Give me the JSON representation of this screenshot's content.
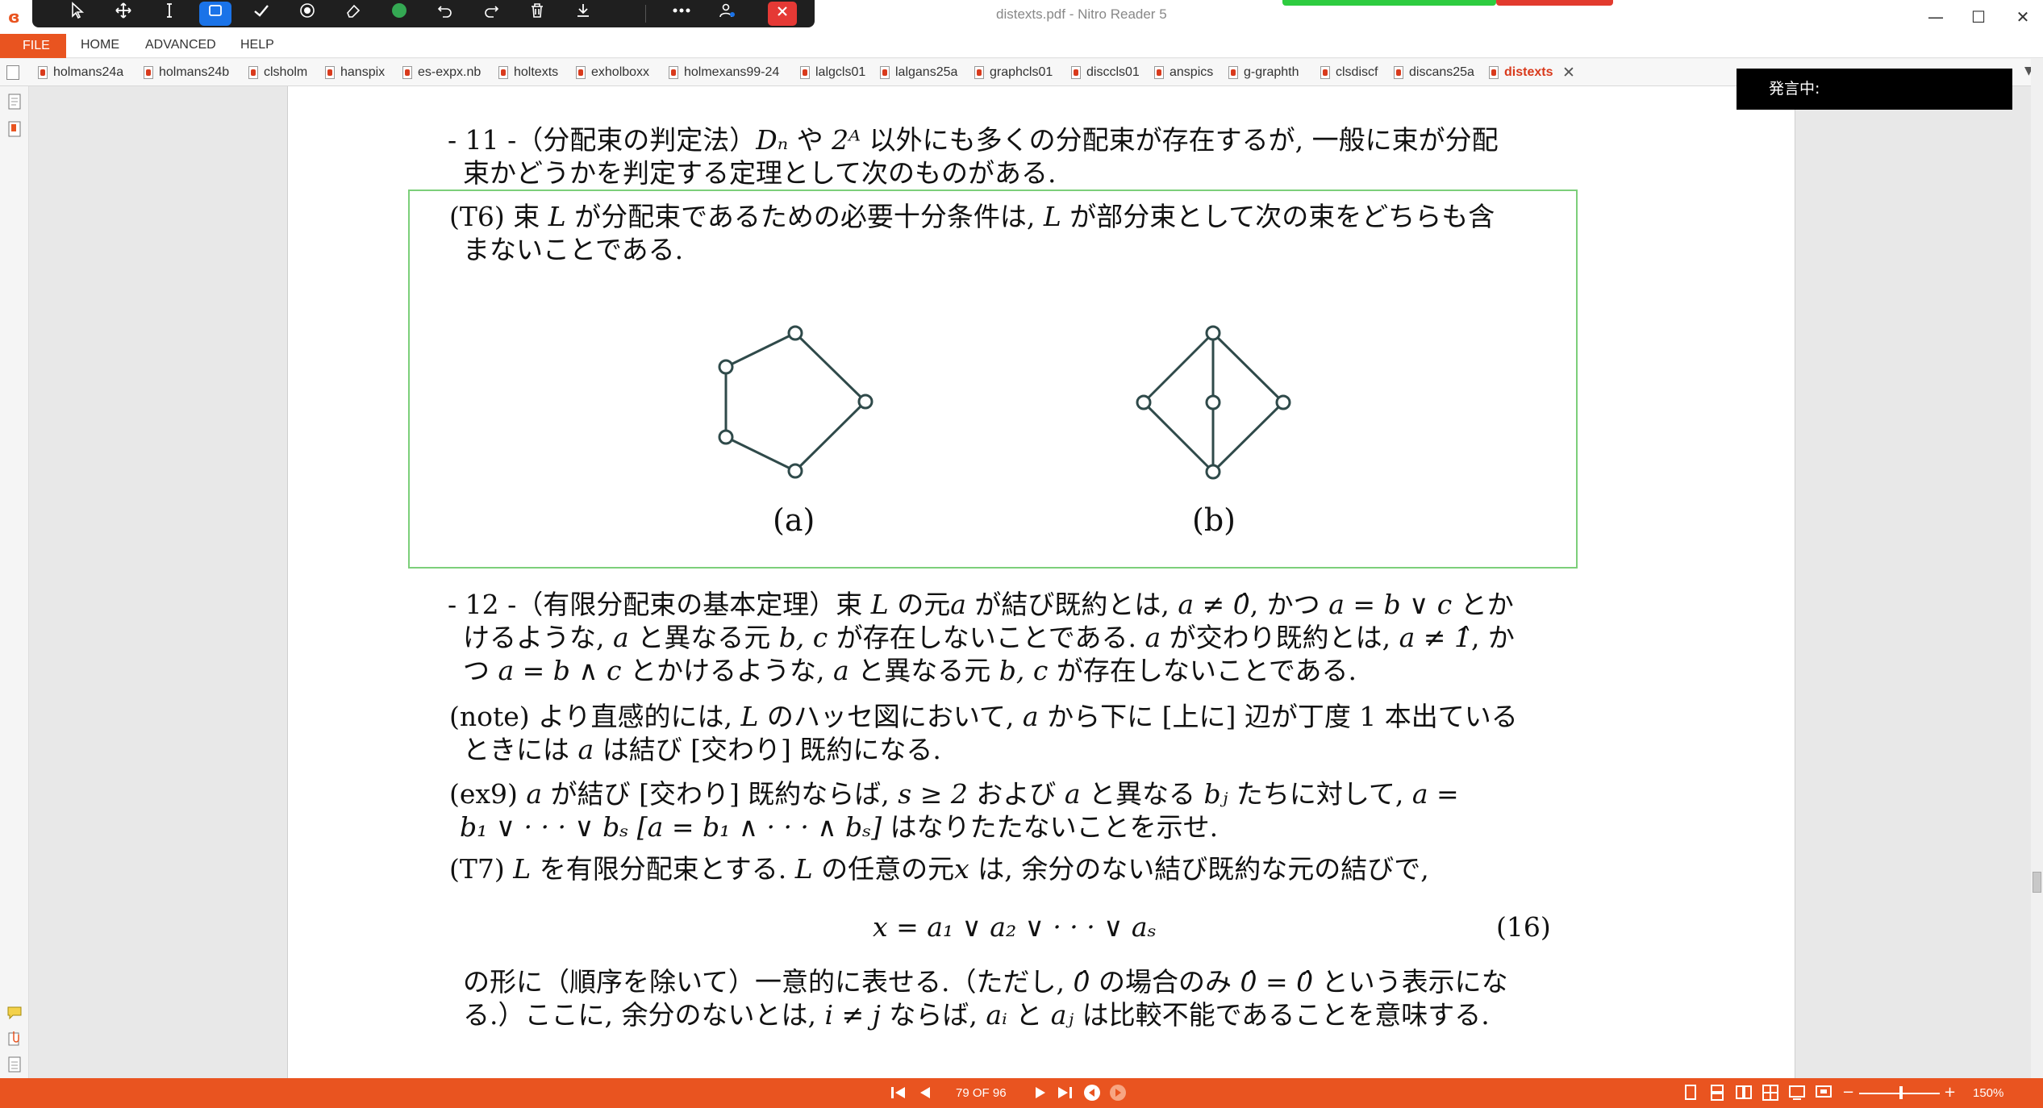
{
  "window": {
    "title": "distexts.pdf - Nitro Reader 5",
    "minimize_glyph": "—",
    "maximize_glyph": "☐",
    "close_glyph": "✕"
  },
  "float_toolbar": {
    "icons": [
      "pointer-icon",
      "move-icon",
      "text-cursor-icon",
      "rectangle-icon",
      "check-icon",
      "target-icon",
      "eraser-icon",
      "color-dot-icon",
      "undo-icon",
      "redo-icon",
      "trash-icon",
      "download-icon",
      "more-icon",
      "people-icon",
      "close-icon"
    ],
    "colors": {
      "active": "#1a73e8",
      "dot": "#34a853",
      "close": "#e53935"
    }
  },
  "menu": {
    "file": "FILE",
    "items": [
      "HOME",
      "ADVANCED",
      "HELP"
    ]
  },
  "tabs": [
    "holmans24a",
    "holmans24b",
    "clsholm",
    "hanspix",
    "es-expx.nb",
    "holtexts",
    "exholboxx",
    "holmexans99-24",
    "lalgcls01",
    "lalgans25a",
    "graphcls01",
    "disccls01",
    "anspics",
    "g-graphth",
    "clsdiscf",
    "discans25a",
    "distexts"
  ],
  "active_tab": "distexts",
  "overlay": {
    "speaking": "発言中:"
  },
  "document": {
    "sec11": {
      "lead": "- 11 -（分配束の判定法）",
      "t1": "や",
      "t2": "以外にも多くの分配束が存在するが, 一般に束が分配",
      "line2": "束かどうかを判定する定理として次のものがある."
    },
    "t6": {
      "lead": "(T6)  束",
      "t1": "が分配束であるための必要十分条件は,",
      "t2": "が部分束として次の束をどちらも含",
      "line2": "まないことである."
    },
    "figure": {
      "label_a": "(a)",
      "label_b": "(b)"
    },
    "sec12": {
      "lead": "- 12 -（有限分配束の基本定理）束",
      "t1": "の元",
      "t2": "が結び既約とは,",
      "t3": ", かつ",
      "t4": "とか",
      "line2a": "けるような,",
      "line2b": "と異なる元",
      "line2c": "が存在しないことである.",
      "line2d": "が交わり既約とは,",
      "line2e": ", か",
      "line3a": "つ",
      "line3b": "とかけるような,",
      "line3c": "と異なる元",
      "line3d": "が存在しないことである."
    },
    "note": {
      "lead": "(note)  より直感的には,",
      "t1": "のハッセ図において,",
      "t2": "から下に [上に] 辺が丁度 1 本出ている",
      "line2a": "ときには",
      "line2b": "は結び [交わり] 既約になる."
    },
    "ex9": {
      "lead": "(ex9)",
      "t1": "が結び [交わり] 既約ならば,",
      "t2": "および",
      "t3": "と異なる",
      "t4": "たちに対して,",
      "line2b": "はなりたたないことを示せ."
    },
    "t7": {
      "lead": "(T7)",
      "t1": "を有限分配束とする.",
      "t2": "の任意の元",
      "t3": "は, 余分のない結び既約な元の結びで,",
      "eq_number": "(16)",
      "line3a": "の形に（順序を除いて）一意的に表せる.（ただし,",
      "line3b": "の場合のみ",
      "line3c": "という表示にな",
      "line4a": "る.）ここに, 余分のないとは,",
      "line4b": "ならば,",
      "line4c": "と",
      "line4d": "は比較不能であることを意味する."
    },
    "math": {
      "Dn": "Dₙ",
      "twoA": "2ᴬ",
      "L": "L",
      "a": "a",
      "a_ne_0": "a ≠ 0̂",
      "a_eq_bvc": "a = b ∨ c",
      "bc": "b, c",
      "a_ne_1": "a ≠ 1̂",
      "a_eq_bwc": "a = b ∧ c",
      "s_ge_2": "s ≥ 2",
      "bj": "bⱼ",
      "a_eq": "a =",
      "ex9_line2": "b₁ ∨ · · · ∨ bₛ [a = b₁ ∧ · · · ∧ bₛ]",
      "x": "x",
      "eq16": "x = a₁ ∨ a₂ ∨ · · · ∨ aₛ",
      "hat0": "0̂",
      "hat0_eq": "0̂ = 0̂",
      "i_ne_j": "i ≠ j",
      "ai": "aᵢ",
      "aj": "aⱼ"
    }
  },
  "status": {
    "page": "79 OF 96",
    "zoom": "150%",
    "zoom_minus": "−",
    "zoom_plus": "+"
  }
}
